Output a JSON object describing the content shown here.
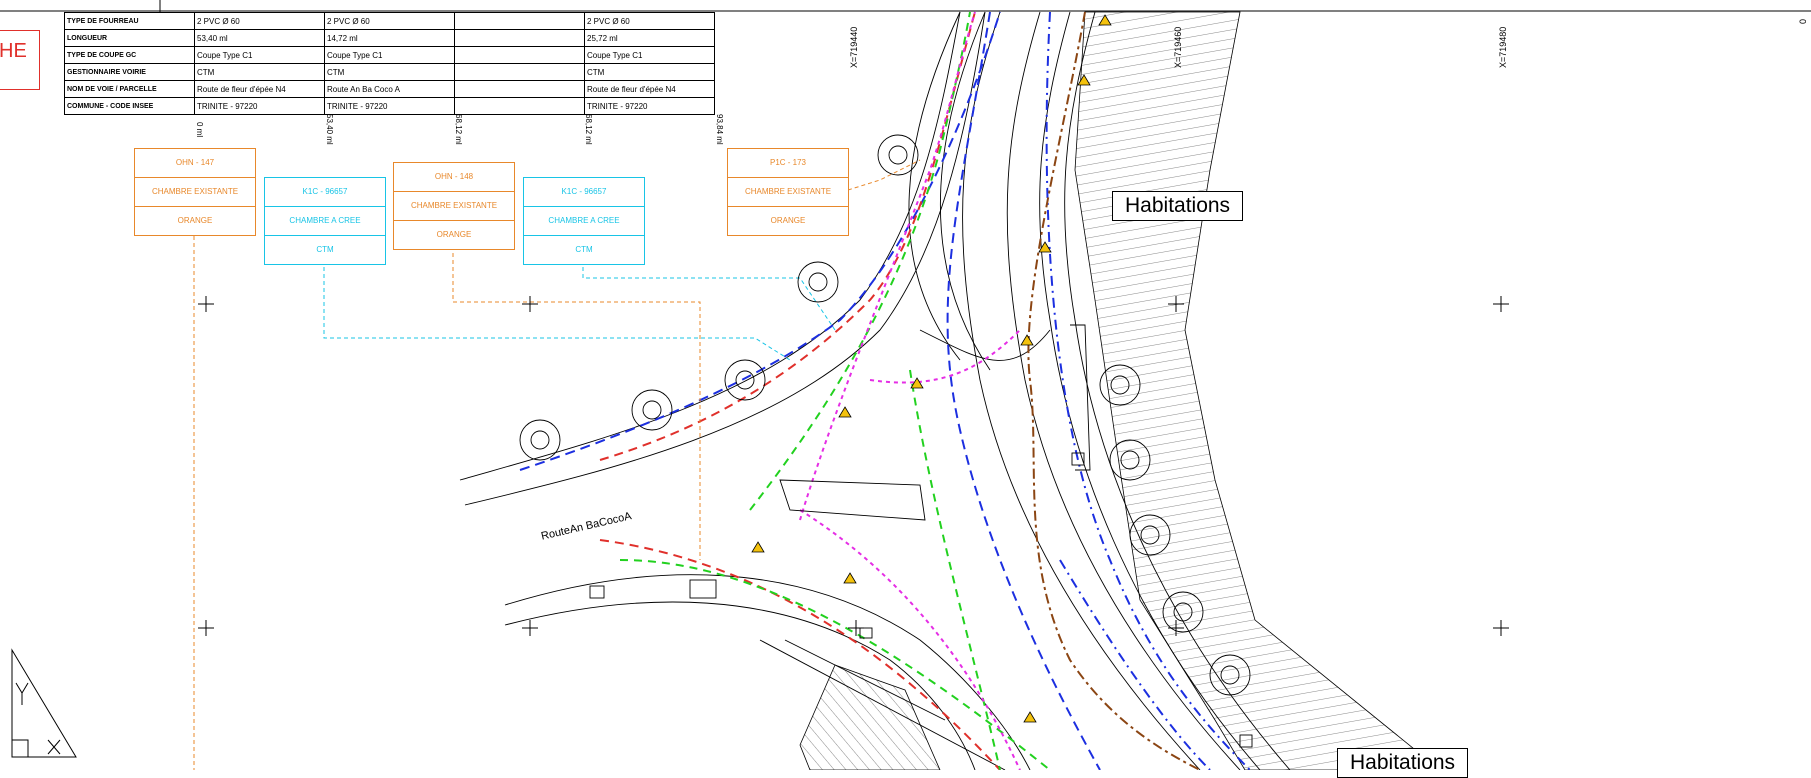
{
  "stamp_text": "HE",
  "table": {
    "rows": [
      {
        "label": "TYPE DE FOURREAU",
        "cells": [
          "2 PVC Ø 60",
          "2 PVC Ø 60",
          "",
          "2 PVC Ø 60"
        ]
      },
      {
        "label": "LONGUEUR",
        "cells": [
          "53,40 ml",
          "14,72 ml",
          "",
          "25,72 ml"
        ]
      },
      {
        "label": "TYPE DE COUPE GC",
        "cells": [
          "Coupe Type C1",
          "Coupe Type C1",
          "",
          "Coupe Type C1"
        ]
      },
      {
        "label": "GESTIONNAIRE VOIRIE",
        "cells": [
          "CTM",
          "CTM",
          "",
          "CTM"
        ]
      },
      {
        "label": "NOM DE VOIE / PARCELLE",
        "cells": [
          "Route de fleur d'épée N4",
          "Route An Ba Coco A",
          "",
          "Route de fleur d'épée N4"
        ]
      },
      {
        "label": "COMMUNE - CODE INSEE",
        "cells": [
          "TRINITE - 97220",
          "TRINITE - 97220",
          "",
          "TRINITE - 97220"
        ]
      }
    ]
  },
  "distances": [
    "0 ml",
    "53,40 ml",
    "68,12 ml",
    "68,12 ml",
    "93,84 ml"
  ],
  "chambers": [
    {
      "id": "OHN - 147",
      "status": "CHAMBRE EXISTANTE",
      "owner": "ORANGE"
    },
    {
      "id": "K1C - 96657",
      "status": "CHAMBRE A CREE",
      "owner": "CTM"
    },
    {
      "id": "OHN - 148",
      "status": "CHAMBRE EXISTANTE",
      "owner": "ORANGE"
    },
    {
      "id": "K1C - 96657",
      "status": "CHAMBRE A CREE",
      "owner": "CTM"
    },
    {
      "id": "P1C - 173",
      "status": "CHAMBRE EXISTANTE",
      "owner": "ORANGE"
    }
  ],
  "coordinates": [
    "X=719440",
    "X=719460",
    "X=719480"
  ],
  "zones": [
    "Habitations",
    "Habitations"
  ],
  "road_label": "RouteAn BaCocoA",
  "corner_text": "0",
  "legend_symbol": "north-arrow-triangle",
  "colors": {
    "orange": "#e8882b",
    "cyan": "#18c4e6",
    "red": "#e0302b",
    "blue": "#1c2fe0",
    "green": "#22d11f",
    "magenta": "#e52ee5",
    "brown": "#8b4513",
    "black": "#000000"
  }
}
